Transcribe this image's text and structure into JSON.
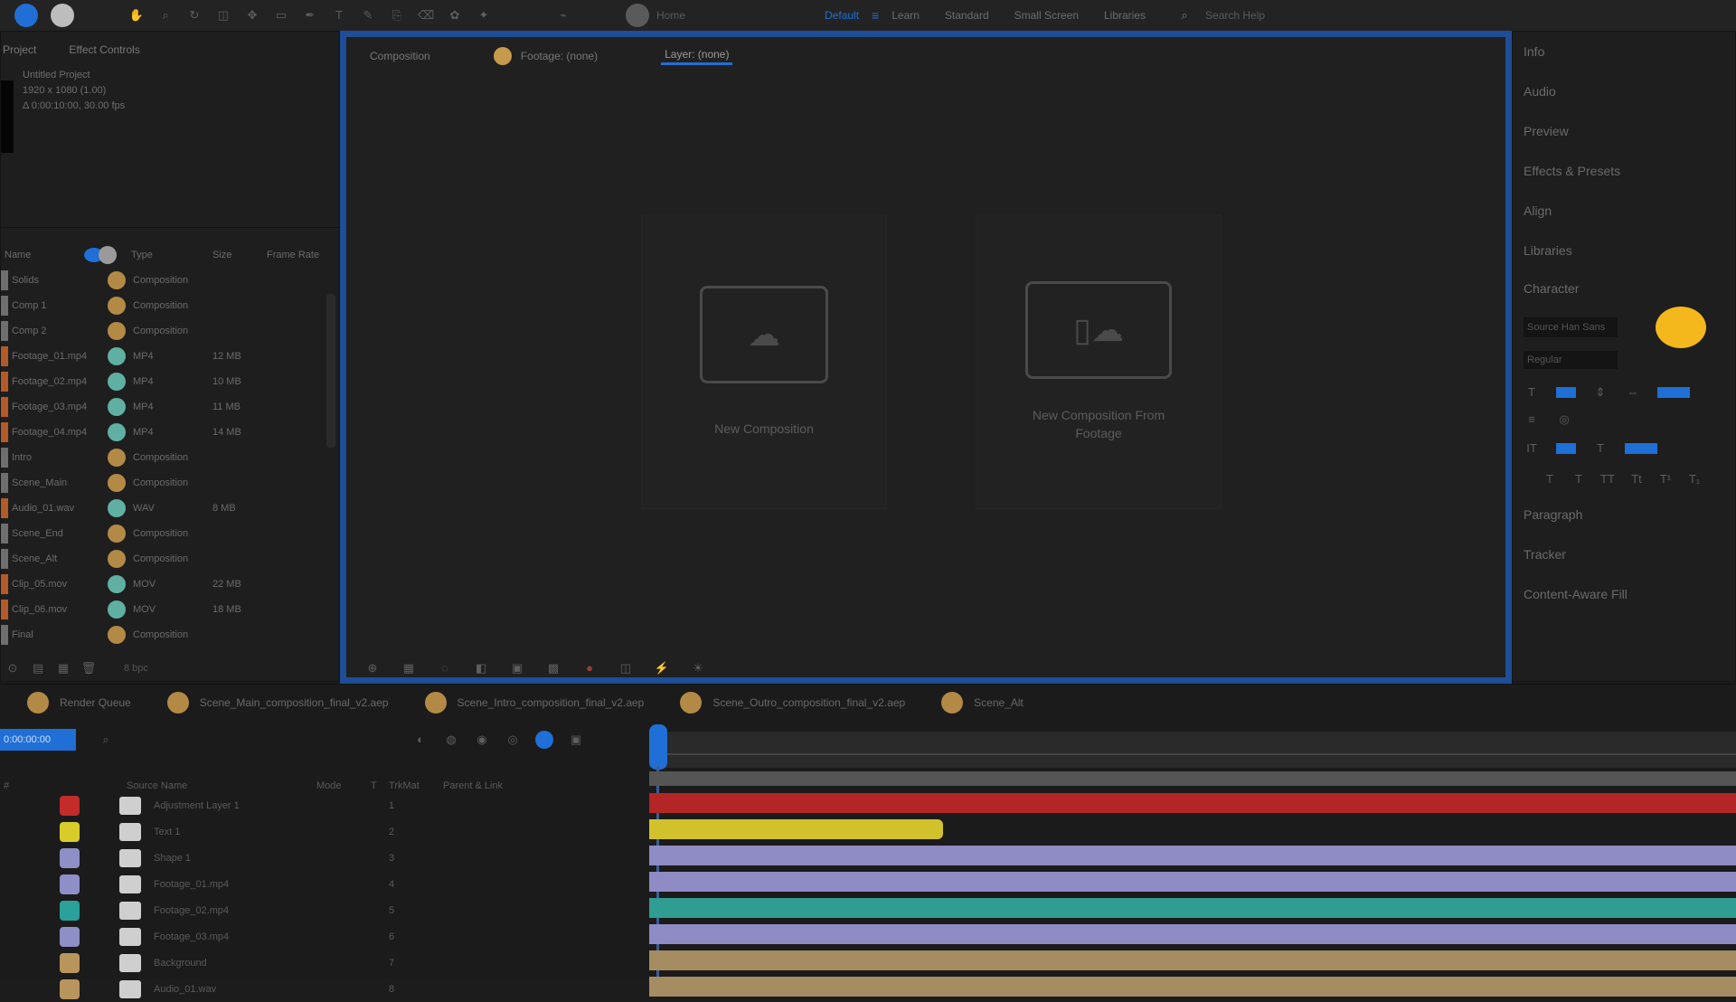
{
  "toolbar": {
    "home_label": "Home",
    "workspaces": [
      {
        "label": "Default",
        "active": true
      },
      {
        "label": "Learn",
        "active": false
      },
      {
        "label": "Standard",
        "active": false
      },
      {
        "label": "Small Screen",
        "active": false
      },
      {
        "label": "Libraries",
        "active": false
      }
    ],
    "search_label": "Search Help"
  },
  "project_panel": {
    "tabs": [
      "Project",
      "Effect Controls"
    ],
    "info_lines": [
      "Untitled Project",
      "1920 x 1080 (1.00)",
      "Δ 0:00:10:00, 30.00 fps"
    ],
    "columns": [
      "Name",
      "Type",
      "Size",
      "Frame Rate"
    ],
    "items": [
      {
        "name": "Solids",
        "type": "Composition",
        "size": "",
        "icon": "comp",
        "swatch": "#6e6e6e"
      },
      {
        "name": "Comp 1",
        "type": "Composition",
        "size": "",
        "icon": "comp",
        "swatch": "#6e6e6e"
      },
      {
        "name": "Comp 2",
        "type": "Composition",
        "size": "",
        "icon": "comp",
        "swatch": "#6e6e6e"
      },
      {
        "name": "Footage_01.mp4",
        "type": "MP4",
        "size": "12 MB",
        "icon": "footage",
        "swatch": "#b35a2a"
      },
      {
        "name": "Footage_02.mp4",
        "type": "MP4",
        "size": "10 MB",
        "icon": "footage",
        "swatch": "#b35a2a"
      },
      {
        "name": "Footage_03.mp4",
        "type": "MP4",
        "size": "11 MB",
        "icon": "footage",
        "swatch": "#b35a2a"
      },
      {
        "name": "Footage_04.mp4",
        "type": "MP4",
        "size": "14 MB",
        "icon": "footage",
        "swatch": "#b35a2a"
      },
      {
        "name": "Intro",
        "type": "Composition",
        "size": "",
        "icon": "comp",
        "swatch": "#6e6e6e"
      },
      {
        "name": "Scene_Main",
        "type": "Composition",
        "size": "",
        "icon": "comp",
        "swatch": "#6e6e6e"
      },
      {
        "name": "Audio_01.wav",
        "type": "WAV",
        "size": "8 MB",
        "icon": "footage",
        "swatch": "#b35a2a"
      },
      {
        "name": "Scene_End",
        "type": "Composition",
        "size": "",
        "icon": "comp",
        "swatch": "#6e6e6e"
      },
      {
        "name": "Scene_Alt",
        "type": "Composition",
        "size": "",
        "icon": "comp",
        "swatch": "#6e6e6e"
      },
      {
        "name": "Clip_05.mov",
        "type": "MOV",
        "size": "22 MB",
        "icon": "footage",
        "swatch": "#b35a2a"
      },
      {
        "name": "Clip_06.mov",
        "type": "MOV",
        "size": "18 MB",
        "icon": "footage",
        "swatch": "#b35a2a"
      },
      {
        "name": "Final",
        "type": "Composition",
        "size": "",
        "icon": "comp",
        "swatch": "#6e6e6e"
      }
    ],
    "footer_label": "8 bpc"
  },
  "viewer": {
    "tabs": [
      {
        "label": "Composition",
        "has_dot": false
      },
      {
        "label": "Footage: (none)",
        "has_dot": true
      },
      {
        "label": "Layer: (none)",
        "has_dot": false,
        "active": true
      }
    ],
    "cards": [
      {
        "label": "New Composition",
        "icon": "comp-icon"
      },
      {
        "label": "New Composition From Footage",
        "icon": "comp-from-footage-icon"
      }
    ]
  },
  "properties": {
    "sections": [
      "Info",
      "Audio",
      "Preview",
      "Effects & Presets",
      "Align",
      "Libraries",
      "Character",
      "Paragraph",
      "Tracker",
      "Content-Aware Fill"
    ],
    "font_name": "Source Han Sans",
    "font_style": "Regular"
  },
  "timeline": {
    "comp_tabs": [
      "Render Queue",
      "Scene_Main_composition_final_v2.aep",
      "Scene_Intro_composition_final_v2.aep",
      "Scene_Outro_composition_final_v2.aep",
      "Scene_Alt"
    ],
    "timecode": "0:00:00:00",
    "columns": [
      "#",
      "Source Name",
      "Mode",
      "T",
      "TrkMat",
      "Parent & Link"
    ],
    "layers": [
      {
        "num": "1",
        "name": "Adjustment Layer 1",
        "label_color": "#c42b2b",
        "track_color": "#b42626",
        "track_end": 1.0
      },
      {
        "num": "2",
        "name": "Text 1",
        "label_color": "#d8cc2a",
        "track_color": "#d1c22b",
        "track_end": 0.27
      },
      {
        "num": "3",
        "name": "Shape 1",
        "label_color": "#8e8fc7",
        "track_color": "#8f8bc4",
        "track_end": 1.0
      },
      {
        "num": "4",
        "name": "Footage_01.mp4",
        "label_color": "#8e8fc7",
        "track_color": "#8f8bc4",
        "track_end": 1.0
      },
      {
        "num": "5",
        "name": "Footage_02.mp4",
        "label_color": "#2aa19a",
        "track_color": "#2f9d92",
        "track_end": 1.0
      },
      {
        "num": "6",
        "name": "Footage_03.mp4",
        "label_color": "#8e8fc7",
        "track_color": "#8f8bc4",
        "track_end": 1.0
      },
      {
        "num": "7",
        "name": "Background",
        "label_color": "#b9955e",
        "track_color": "#a58c61",
        "track_end": 1.0
      },
      {
        "num": "8",
        "name": "Audio_01.wav",
        "label_color": "#b9955e",
        "track_color": "#a58c61",
        "track_end": 1.0
      }
    ]
  }
}
